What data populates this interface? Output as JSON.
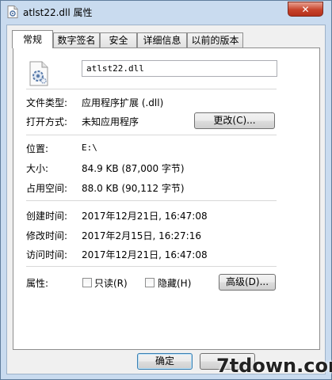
{
  "window": {
    "title": "atlst22.dll 属性",
    "close_label": "✕"
  },
  "tabs": [
    {
      "label": "常规",
      "active": true
    },
    {
      "label": "数字签名",
      "active": false
    },
    {
      "label": "安全",
      "active": false
    },
    {
      "label": "详细信息",
      "active": false
    },
    {
      "label": "以前的版本",
      "active": false
    }
  ],
  "general": {
    "file_name": "atlst22.dll",
    "file_type_label": "文件类型:",
    "file_type_value": "应用程序扩展 (.dll)",
    "opens_with_label": "打开方式:",
    "opens_with_value": "未知应用程序",
    "change_button": "更改(C)...",
    "location_label": "位置:",
    "location_value": "E:\\",
    "size_label": "大小:",
    "size_value": "84.9 KB (87,000 字节)",
    "size_on_disk_label": "占用空间:",
    "size_on_disk_value": "88.0 KB (90,112 字节)",
    "created_label": "创建时间:",
    "created_value": "2017年12月21日, 16:47:08",
    "modified_label": "修改时间:",
    "modified_value": "2017年2月15日, 16:27:16",
    "accessed_label": "访问时间:",
    "accessed_value": "2017年12月21日, 16:47:08",
    "attributes_label": "属性:",
    "readonly_label": "只读(R)",
    "hidden_label": "隐藏(H)",
    "advanced_button": "高级(D)..."
  },
  "footer": {
    "ok_button": "确定"
  },
  "watermark": "7tdown.com"
}
